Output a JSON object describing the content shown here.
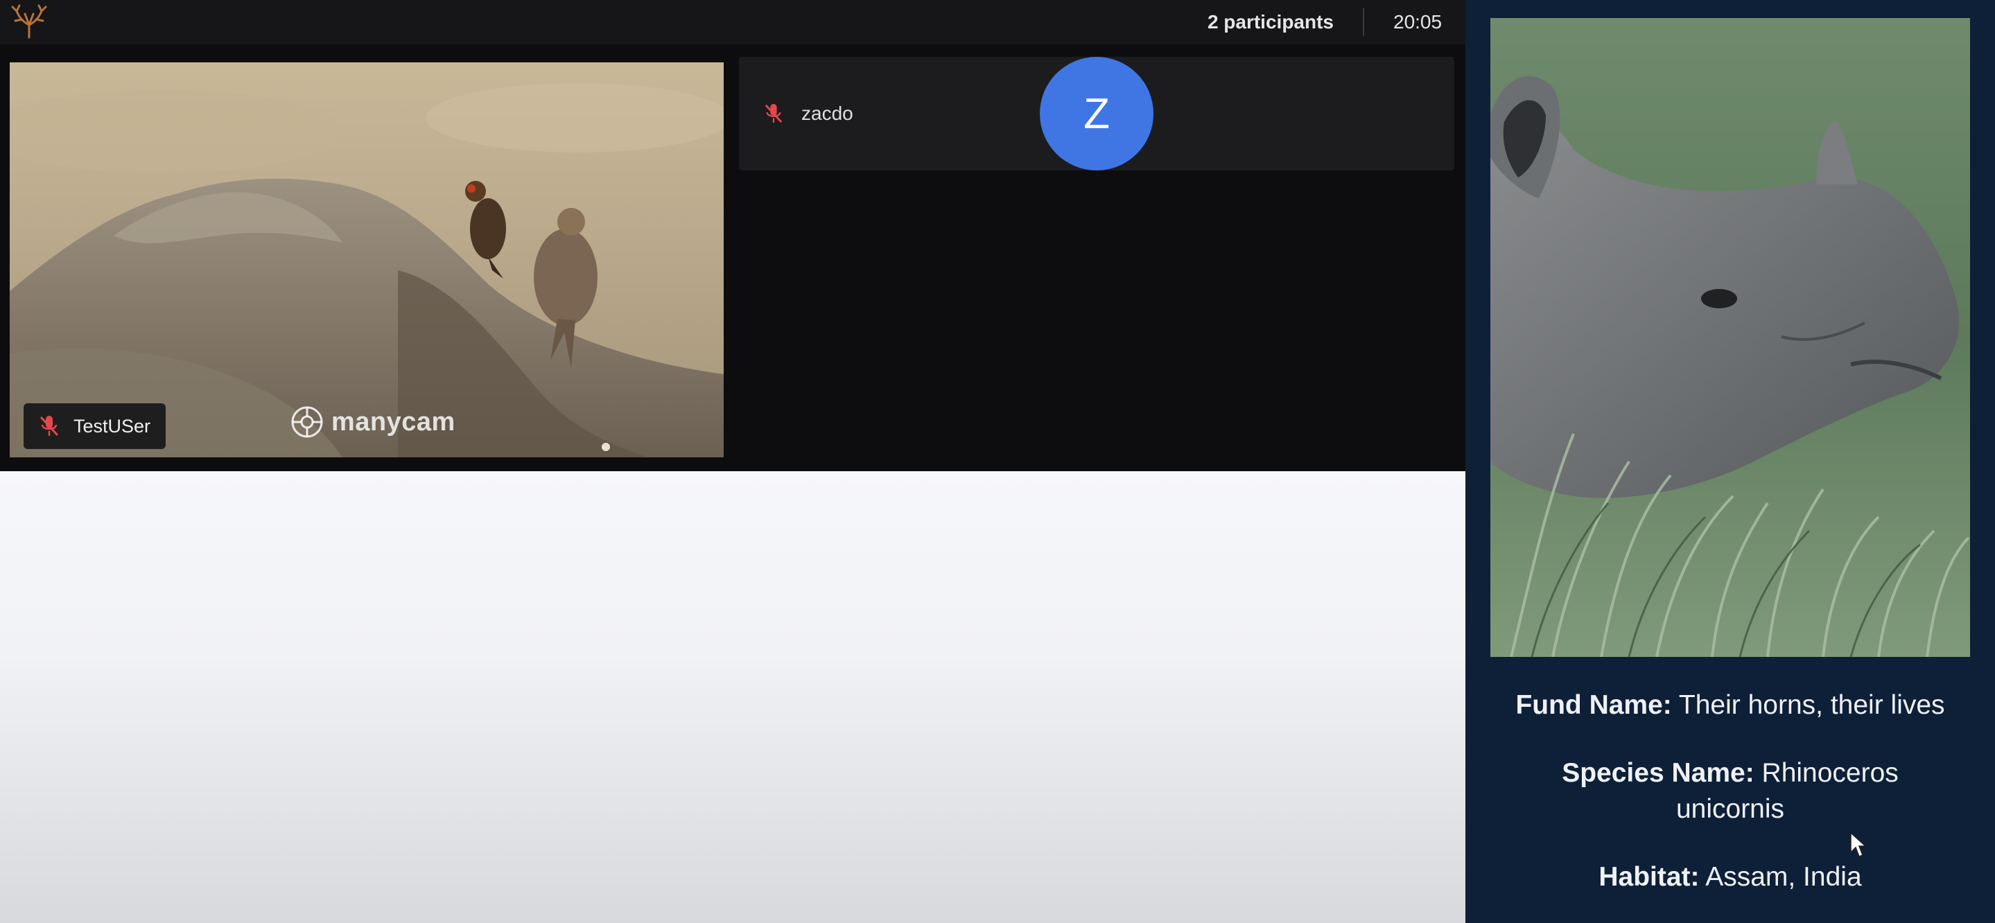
{
  "header": {
    "participants": "2 participants",
    "time": "20:05"
  },
  "tiles": {
    "local": {
      "name": "TestUSer",
      "watermark": "manycam"
    },
    "remote": {
      "name": "zacdo",
      "avatar_letter": "Z",
      "avatar_color": "#3f76e4"
    }
  },
  "info": {
    "fund_label": "Fund Name:",
    "fund_value": " Their horns, their lives",
    "species_label": "Species Name:",
    "species_value_1": " Rhinoceros",
    "species_value_2": "unicornis",
    "habitat_label": "Habitat:",
    "habitat_value": " Assam, India"
  },
  "colors": {
    "panel_bg": "#0e1f38",
    "mic_off": "#e5484d"
  }
}
